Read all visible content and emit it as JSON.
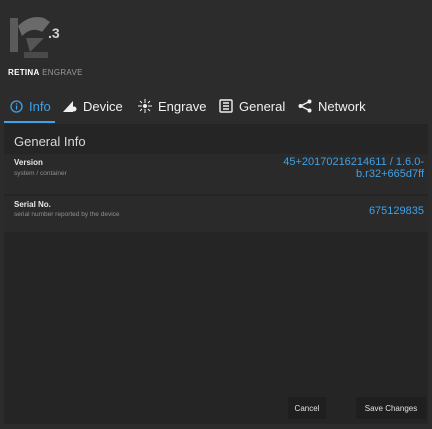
{
  "brand": {
    "name_bold": "RETINA",
    "name_light": " ENGRAVE"
  },
  "tabs": [
    {
      "label": "Info",
      "icon": "info-icon"
    },
    {
      "label": "Device",
      "icon": "device-icon"
    },
    {
      "label": "Engrave",
      "icon": "engrave-icon"
    },
    {
      "label": "General",
      "icon": "general-icon"
    },
    {
      "label": "Network",
      "icon": "network-icon"
    }
  ],
  "section": {
    "title": "General Info"
  },
  "rows": [
    {
      "label": "Version",
      "desc": "system / container",
      "value": "45+20170216214611 / 1.6.0-b.r32+665d7ff"
    },
    {
      "label": "Serial No.",
      "desc": "serial number reported by the device",
      "value": "675129835"
    }
  ],
  "buttons": {
    "cancel": "Cancel",
    "save": "Save Changes"
  },
  "colors": {
    "accent": "#3fa1e6",
    "background": "#2c2c2c",
    "panel": "#252525"
  }
}
